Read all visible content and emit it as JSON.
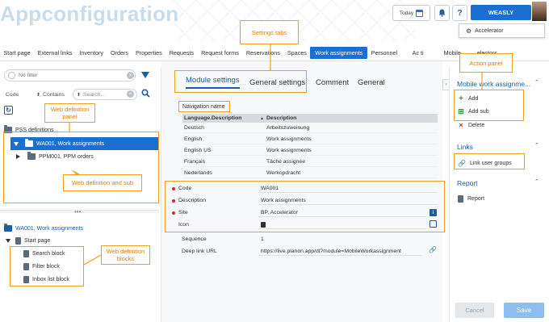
{
  "header": {
    "app_title": "Appconfiguration",
    "today_label": "Today",
    "help_label": "?",
    "user_name": "WEASLY",
    "accelerator_label": "Accelerator"
  },
  "nav": {
    "tabs": [
      "Start page",
      "External links",
      "Inventory",
      "Orders",
      "Properties",
      "Requests",
      "Request forms",
      "Reservations",
      "Spaces",
      "Work assignments",
      "Personnel",
      "Ac",
      "ti",
      "Mobile",
      "electors"
    ],
    "active": "Work assignments"
  },
  "left": {
    "filter_placeholder": "No filter",
    "field_select": "Code",
    "operator_select": "Contains",
    "search_placeholder": "Search...",
    "root_label": "PSS definitions",
    "selected_item": "WA001, Work assignments",
    "child_item": "PPM001, PPM orders",
    "lower_title": "WA001, Work assignments",
    "start_page": "Start page",
    "blocks": [
      "Search block",
      "Filter block",
      "Inbox list block"
    ]
  },
  "callouts": {
    "settings_tabs": "Settings tabs",
    "action_panel": "Action panel",
    "web_def_panel": "Web definition panel",
    "web_def_sub": "Web definition and sub",
    "web_def_blocks": "Web definition blocks"
  },
  "main": {
    "tabs": [
      "Module settings",
      "General settings",
      "Comment",
      "General"
    ],
    "active_tab": "Module settings",
    "nav_name_label": "Navigation name",
    "grid_headers": [
      "Language.Description",
      "Description"
    ],
    "grid_rows": [
      [
        "Deutsch",
        "Arbeitszuweisung"
      ],
      [
        "English",
        "Work assignments"
      ],
      [
        "English US",
        "Work assignments"
      ],
      [
        "Français",
        "Tâche assignée"
      ],
      [
        "Nederlands",
        "Werkopdracht"
      ]
    ],
    "fields": {
      "code_label": "Code",
      "code_value": "WA001",
      "desc_label": "Description",
      "desc_value": "Work assignments",
      "site_label": "Site",
      "site_value": "BP, Accelerator",
      "icon_label": "Icon",
      "seq_label": "Sequence",
      "seq_value": "1",
      "deeplink_label": "Deep link URL",
      "deeplink_value": "https://live.planon.app/dl?module=MobileWorkassignment"
    }
  },
  "right": {
    "panel_title": "Mobile work assignme...",
    "actions": [
      "Add",
      "Add sub",
      "Delete"
    ],
    "links_title": "Links",
    "link_user_groups": "Link user groups",
    "report_title": "Report",
    "report_item": "Report",
    "cancel_label": "Cancel",
    "save_label": "Save"
  },
  "colors": {
    "primary": "#1b6fd1",
    "accent_orange": "#f0a020",
    "required": "#d9272e",
    "add_green": "#2e9b3a"
  }
}
